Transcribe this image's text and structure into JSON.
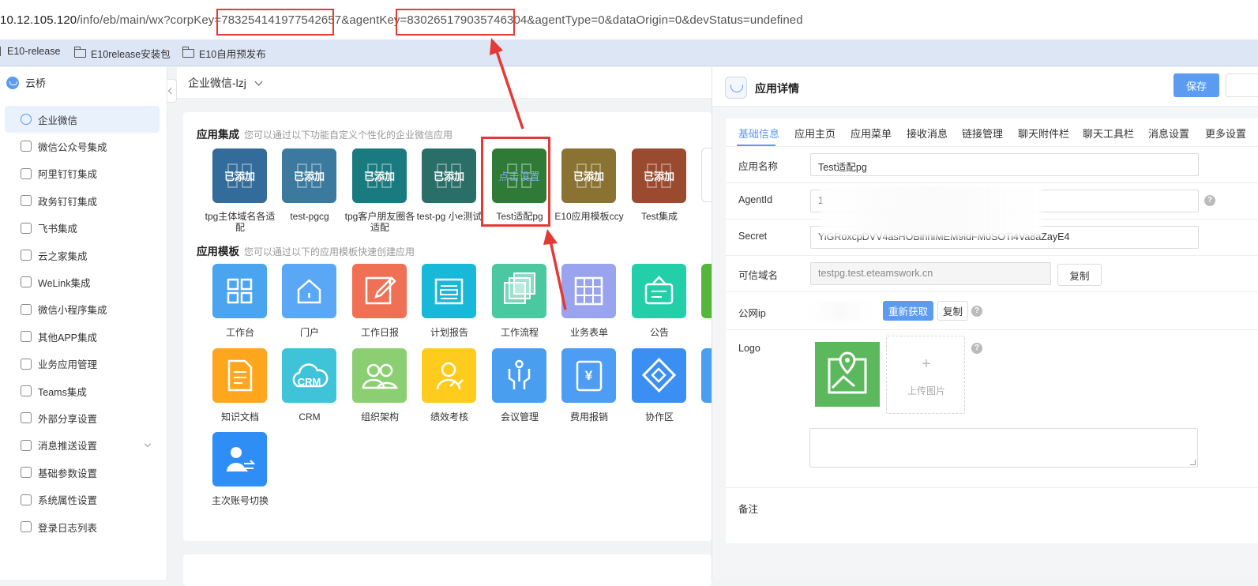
{
  "browser": {
    "url_pre": "10.12.105.120",
    "url_path": "/info/eb/main/wx?corpKey=",
    "corp_key": "783254141977542657",
    "url_mid": "&agentKey=",
    "agent_key": "830265179035746304",
    "url_post": "&agentType=0&dataOrigin=0&devStatus=undefined",
    "bookmarks": [
      "E10-release",
      "E10release安装包",
      "E10自用预发布"
    ]
  },
  "sidebar": {
    "title": "云桥",
    "items": [
      {
        "label": "企业微信",
        "active": true
      },
      {
        "label": "微信公众号集成"
      },
      {
        "label": "阿里钉钉集成"
      },
      {
        "label": "政务钉钉集成"
      },
      {
        "label": "飞书集成"
      },
      {
        "label": "云之家集成"
      },
      {
        "label": "WeLink集成"
      },
      {
        "label": "微信小程序集成"
      },
      {
        "label": "其他APP集成"
      },
      {
        "label": "业务应用管理"
      },
      {
        "label": "Teams集成"
      },
      {
        "label": "外部分享设置"
      },
      {
        "label": "消息推送设置",
        "expandable": true
      },
      {
        "label": "基础参数设置"
      },
      {
        "label": "系统属性设置"
      },
      {
        "label": "登录日志列表"
      }
    ]
  },
  "center": {
    "selector": "企业微信-lzj",
    "integration": {
      "title": "应用集成",
      "hint": "您可以通过以下功能自定义个性化的企业微信应用",
      "apps": [
        {
          "label": "tpg主体域名各适配",
          "badge": "已添加",
          "color": "#336b9a"
        },
        {
          "label": "test-pgcg",
          "badge": "已添加",
          "color": "#3b7a9e"
        },
        {
          "label": "tpg客户朋友圈各适配",
          "badge": "已添加",
          "color": "#197a80"
        },
        {
          "label": "test-pg 小e测试",
          "badge": "已添加",
          "color": "#2a6e68"
        },
        {
          "label": "Test适配pg",
          "badge": "点击设置",
          "color": "#2e7a36"
        },
        {
          "label": "E10应用模板ccy",
          "badge": "已添加",
          "color": "#8a7232"
        },
        {
          "label": "Test集成",
          "badge": "已添加",
          "color": "#9a4a2e"
        }
      ]
    },
    "templates": {
      "title": "应用模板",
      "hint": "您可以通过以下的应用模板快速创建应用",
      "apps": [
        {
          "label": "工作台",
          "color": "#4aa4f0",
          "icon": "grid-icon"
        },
        {
          "label": "门户",
          "color": "#5aa8f5",
          "icon": "house-icon"
        },
        {
          "label": "工作日报",
          "color": "#f07055",
          "icon": "edit-icon"
        },
        {
          "label": "计划报告",
          "color": "#18b8d8",
          "icon": "report-icon"
        },
        {
          "label": "工作流程",
          "color": "#4cc8a0",
          "icon": "flow-icon"
        },
        {
          "label": "业务表单",
          "color": "#9aa4ee",
          "icon": "table-icon"
        },
        {
          "label": "公告",
          "color": "#22cfa8",
          "icon": "notice-icon"
        },
        {
          "label": "知识文档",
          "color": "#ffa51e",
          "icon": "document-icon"
        },
        {
          "label": "CRM",
          "color": "#3fc3d8",
          "icon": "crm-cloud-icon",
          "text": "CRM"
        },
        {
          "label": "组织架构",
          "color": "#8ccf72",
          "icon": "people-icon"
        },
        {
          "label": "绩效考核",
          "color": "#ffcc1e",
          "icon": "person-chart-icon"
        },
        {
          "label": "会议管理",
          "color": "#4a9ef0",
          "icon": "meeting-icon"
        },
        {
          "label": "费用报销",
          "color": "#4d9df5",
          "icon": "yuan-icon",
          "text": "¥"
        },
        {
          "label": "协作区",
          "color": "#3b8ff2",
          "icon": "handshake-icon"
        },
        {
          "label": "主次账号切换",
          "color": "#2f8ef5",
          "icon": "account-switch-icon"
        }
      ]
    }
  },
  "detail": {
    "title": "应用详情",
    "save_label": "保存",
    "tabs": [
      "基础信息",
      "应用主页",
      "应用菜单",
      "接收消息",
      "链接管理",
      "聊天附件栏",
      "聊天工具栏",
      "消息设置",
      "更多设置"
    ],
    "fields": {
      "name_label": "应用名称",
      "name_value": "Test适配pg",
      "agentid_label": "AgentId",
      "agentid_value": "1",
      "secret_label": "Secret",
      "secret_value": "YiGRoxcpDVV4asHOBlhhiMEM9ldFM0SOTi4Va8aZayE4",
      "domain_label": "可信域名",
      "domain_value": "testpg.test.eteamswork.cn",
      "copy_label": "复制",
      "ip_label": "公网ip",
      "refresh_label": "重新获取",
      "copy_label2": "复制",
      "logo_label": "Logo",
      "upload_label": "上传图片",
      "upload_plus": "+",
      "note_label": "备注",
      "help_mark": "?"
    }
  }
}
